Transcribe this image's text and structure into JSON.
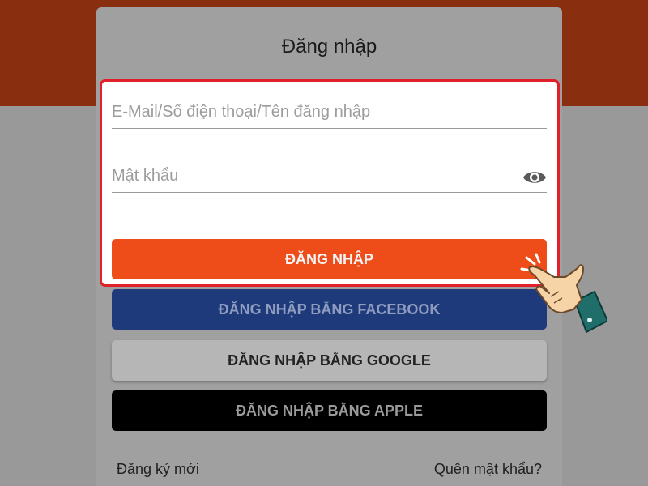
{
  "form": {
    "title": "Đăng nhập",
    "email_placeholder": "E-Mail/Số điện thoại/Tên đăng nhập",
    "password_placeholder": "Mật khẩu",
    "password_toggle_icon": "eye-icon"
  },
  "buttons": {
    "login": "ĐĂNG NHẬP",
    "facebook": "ĐĂNG NHẬP BẰNG FACEBOOK",
    "google": "ĐĂNG NHẬP BẰNG GOOGLE",
    "apple": "ĐĂNG NHẬP BẰNG APPLE"
  },
  "links": {
    "register": "Đăng ký mới",
    "forgot_password": "Quên mật khẩu?"
  },
  "colors": {
    "brand_orange": "#ee4d1a",
    "highlight_border": "#e0202a",
    "facebook_blue": "#1f3a7a",
    "apple_black": "#000000"
  },
  "annotation": {
    "pointer_icon": "pointing-hand-icon"
  }
}
